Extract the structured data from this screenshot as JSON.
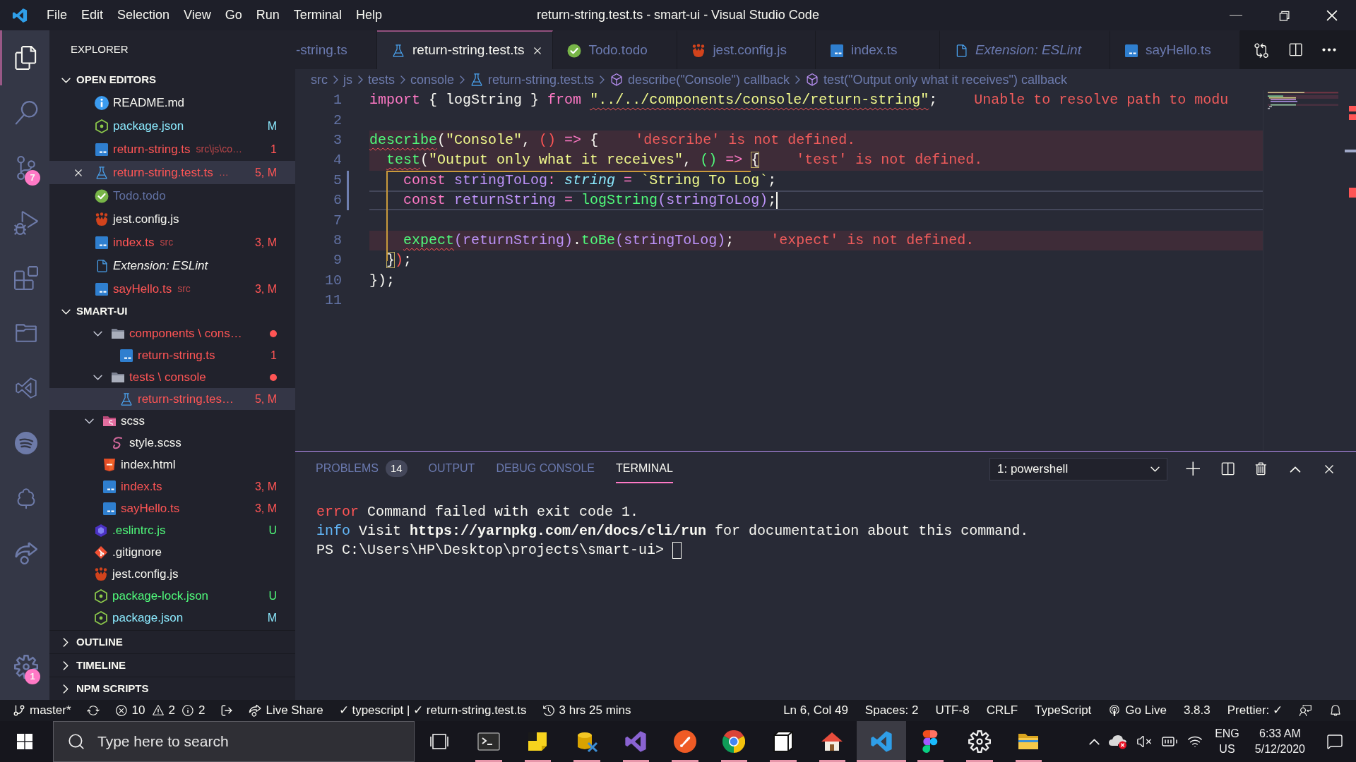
{
  "title_bar": {
    "menu": [
      "File",
      "Edit",
      "Selection",
      "View",
      "Go",
      "Run",
      "Terminal",
      "Help"
    ],
    "title": "return-string.test.ts - smart-ui - Visual Studio Code"
  },
  "activity_bar": {
    "items": [
      {
        "kind": "explorer",
        "selected": true
      },
      {
        "kind": "search",
        "selected": false
      },
      {
        "kind": "scm",
        "selected": false,
        "badge": "7"
      },
      {
        "kind": "debug",
        "selected": false
      },
      {
        "kind": "extensions",
        "selected": false
      },
      {
        "kind": "projects",
        "selected": false
      },
      {
        "kind": "studio",
        "selected": false
      },
      {
        "kind": "music",
        "selected": false
      },
      {
        "kind": "tests",
        "selected": false
      },
      {
        "kind": "share",
        "selected": false
      }
    ],
    "bottom": [
      {
        "kind": "settings",
        "selected": false,
        "badge": "1"
      }
    ]
  },
  "sidebar": {
    "title": "EXPLORER",
    "open_editors": {
      "title": "OPEN EDITORS",
      "expanded": true,
      "items": [
        {
          "label": "README.md",
          "kind": "info",
          "color": "#f8f8f2",
          "selected": false
        },
        {
          "label": "package.json",
          "kind": "node",
          "color": "#8be9fd",
          "badge": "M",
          "selected": false
        },
        {
          "label": "return-string.ts",
          "description": "src\\js\\co…",
          "kind": "ts",
          "color": "#ff5555",
          "badge": "1",
          "selected": false
        },
        {
          "label": "return-string.test.ts",
          "description": "…",
          "kind": "test",
          "color": "#ff5555",
          "badge": "5, M",
          "selected": true
        },
        {
          "label": "Todo.todo",
          "kind": "todo",
          "color": "#6272a4",
          "selected": false
        },
        {
          "label": "jest.config.js",
          "kind": "jest",
          "color": "#f8f8f2",
          "selected": false
        },
        {
          "label": "index.ts",
          "description": "src",
          "kind": "ts",
          "color": "#ff5555",
          "badge": "3, M",
          "selected": false
        },
        {
          "label": "Extension: ESLint",
          "kind": "extension",
          "color": "#f8f8f2",
          "selected": false
        },
        {
          "label": "sayHello.ts",
          "description": "src",
          "kind": "ts",
          "color": "#ff5555",
          "badge": "3, M",
          "selected": false
        }
      ]
    },
    "folder": {
      "title": "SMART-UI",
      "expanded": true,
      "items": [
        {
          "children": [
            {
              "children": [
                {
                  "label": "components \\ cons…",
                  "kind": "folder",
                  "color": "#ff5555",
                  "expanded": true,
                  "selected": false,
                  "children": [
                    {
                      "label": "return-string.ts",
                      "kind": "ts",
                      "color": "#ff5555",
                      "badge": "1",
                      "selected": false
                    }
                  ]
                },
                {
                  "label": "tests \\ console",
                  "kind": "folder",
                  "color": "#ff5555",
                  "expanded": true,
                  "selected": false,
                  "children": [
                    {
                      "label": "return-string.tes…",
                      "kind": "test",
                      "color": "#ff5555",
                      "badge": "5, M",
                      "selected": true
                    }
                  ]
                }
              ]
            },
            {
              "label": "scss",
              "kind": "sass-folder",
              "color": "#f8f8f2",
              "expanded": true,
              "selected": false,
              "children": [
                {
                  "label": "style.scss",
                  "kind": "scss",
                  "color": "#f8f8f2",
                  "selected": false
                }
              ]
            },
            {
              "label": "index.html",
              "kind": "html",
              "color": "#f8f8f2",
              "selected": false
            },
            {
              "label": "index.ts",
              "kind": "ts",
              "color": "#ff5555",
              "badge": "3, M",
              "selected": false
            },
            {
              "label": "sayHello.ts",
              "kind": "ts",
              "color": "#ff5555",
              "badge": "3, M",
              "selected": false
            }
          ]
        },
        {
          "label": ".eslintrc.js",
          "kind": "eslint",
          "color": "#50fa7b",
          "badge": "U",
          "selected": false
        },
        {
          "label": ".gitignore",
          "kind": "git",
          "color": "#f8f8f2",
          "selected": false
        },
        {
          "label": "jest.config.js",
          "kind": "jest",
          "color": "#f8f8f2",
          "selected": false
        },
        {
          "label": "package-lock.json",
          "kind": "node",
          "color": "#50fa7b",
          "badge": "U",
          "selected": false
        },
        {
          "label": "package.json",
          "kind": "node",
          "color": "#8be9fd",
          "badge": "M",
          "selected": false
        }
      ]
    },
    "sections": [
      {
        "title": "OUTLINE",
        "expanded": false
      },
      {
        "title": "TIMELINE",
        "expanded": false
      },
      {
        "title": "NPM SCRIPTS",
        "expanded": false
      }
    ]
  },
  "tabs": [
    {
      "label": "-string.ts",
      "kind": "partial",
      "selected": false
    },
    {
      "label": "return-string.test.ts",
      "kind": "test",
      "selected": true
    },
    {
      "label": "Todo.todo",
      "kind": "todo",
      "selected": false
    },
    {
      "label": "jest.config.js",
      "kind": "jest",
      "selected": false
    },
    {
      "label": "index.ts",
      "kind": "ts",
      "selected": false
    },
    {
      "label": "Extension: ESLint",
      "kind": "extension",
      "selected": false
    },
    {
      "label": "sayHello.ts",
      "kind": "ts",
      "selected": false
    }
  ],
  "breadcrumb": [
    {
      "label": "src",
      "kind": "folder"
    },
    {
      "label": "js",
      "kind": "folder"
    },
    {
      "label": "tests",
      "kind": "folder"
    },
    {
      "label": "console",
      "kind": "folder"
    },
    {
      "label": "return-string.test.ts",
      "kind": "test"
    },
    {
      "label": "describe(\"Console\") callback",
      "kind": "symbol"
    },
    {
      "label": "test(\"Output only what it receives\") callback",
      "kind": "symbol"
    }
  ],
  "editor": {
    "lines": [
      {
        "number": "1",
        "highlight": false,
        "current": false,
        "changed": false,
        "tokens": [
          {
            "text": "import",
            "kind": "keyword"
          },
          {
            "text": " { ",
            "kind": "punct"
          },
          {
            "text": "logString",
            "kind": "plain"
          },
          {
            "text": " } ",
            "kind": "punct"
          },
          {
            "text": "from ",
            "kind": "keyword"
          },
          {
            "text": "\"../../components/console/return-string\"",
            "kind": "string",
            "squiggle": true
          },
          {
            "text": ";",
            "kind": "punct"
          }
        ],
        "message": "Unable to resolve path to modu"
      },
      {
        "number": "2",
        "highlight": false,
        "current": false,
        "changed": false
      },
      {
        "number": "3",
        "highlight": true,
        "current": false,
        "changed": false,
        "tokens": [
          {
            "text": "describe",
            "kind": "function",
            "squiggle": true
          },
          {
            "text": "(",
            "kind": "punct"
          },
          {
            "text": "\"Console\"",
            "kind": "string"
          },
          {
            "text": ", ",
            "kind": "punct"
          },
          {
            "text": "()",
            "kind": "paren-red"
          },
          {
            "text": " => ",
            "kind": "keyword"
          },
          {
            "text": "{",
            "kind": "punct"
          }
        ],
        "message": "'describe' is not defined."
      },
      {
        "number": "4",
        "highlight": true,
        "current": false,
        "changed": false,
        "tokens": [
          {
            "text": "  test",
            "kind": "function",
            "squiggle": true
          },
          {
            "text": "(",
            "kind": "punct"
          },
          {
            "text": "\"Output only what it receives\"",
            "kind": "string"
          },
          {
            "text": ", ",
            "kind": "punct"
          },
          {
            "text": "()",
            "kind": "paren-green"
          },
          {
            "text": " => ",
            "kind": "keyword"
          },
          {
            "text": "{",
            "kind": "bracket-match"
          }
        ],
        "message": "'test' is not defined."
      },
      {
        "number": "5",
        "highlight": false,
        "current": false,
        "changed": true,
        "tokens": [
          {
            "text": "    const ",
            "kind": "keyword"
          },
          {
            "text": "stringToLog",
            "kind": "variable"
          },
          {
            "text": ": ",
            "kind": "keyword"
          },
          {
            "text": "string",
            "kind": "type"
          },
          {
            "text": " = ",
            "kind": "keyword"
          },
          {
            "text": "`String To Log`",
            "kind": "string"
          },
          {
            "text": ";",
            "kind": "punct"
          }
        ]
      },
      {
        "number": "6",
        "highlight": false,
        "current": true,
        "changed": true,
        "tokens": [
          {
            "text": "    const ",
            "kind": "keyword"
          },
          {
            "text": "returnString",
            "kind": "variable"
          },
          {
            "text": " = ",
            "kind": "keyword"
          },
          {
            "text": "logString",
            "kind": "function"
          },
          {
            "text": "(",
            "kind": "paren-purple"
          },
          {
            "text": "stringToLog",
            "kind": "variable"
          },
          {
            "text": ")",
            "kind": "paren-purple"
          },
          {
            "text": ";",
            "kind": "punct"
          }
        ]
      },
      {
        "number": "7",
        "highlight": false,
        "current": false,
        "changed": false
      },
      {
        "number": "8",
        "highlight": true,
        "current": false,
        "changed": false,
        "tokens": [
          {
            "text": "    expect",
            "kind": "function",
            "squiggle": true
          },
          {
            "text": "(",
            "kind": "paren-purple"
          },
          {
            "text": "returnString",
            "kind": "variable"
          },
          {
            "text": ")",
            "kind": "paren-purple"
          },
          {
            "text": ".",
            "kind": "punct"
          },
          {
            "text": "toBe",
            "kind": "function"
          },
          {
            "text": "(",
            "kind": "paren-purple"
          },
          {
            "text": "stringToLog",
            "kind": "variable"
          },
          {
            "text": ")",
            "kind": "paren-purple"
          },
          {
            "text": ";",
            "kind": "punct"
          }
        ],
        "message": "'expect' is not defined."
      },
      {
        "number": "9",
        "highlight": false,
        "current": false,
        "changed": false,
        "tokens": [
          {
            "text": "  }",
            "kind": "bracket-match"
          },
          {
            "text": ")",
            "kind": "paren-red"
          },
          {
            "text": ";",
            "kind": "punct"
          }
        ]
      },
      {
        "number": "10",
        "highlight": false,
        "current": false,
        "changed": false,
        "tokens": [
          {
            "text": "});",
            "kind": "punct"
          }
        ]
      },
      {
        "number": "11",
        "highlight": false,
        "current": false,
        "changed": false
      }
    ]
  },
  "panel": {
    "tabs": [
      {
        "label": "PROBLEMS",
        "badge": "14",
        "selected": false
      },
      {
        "label": "OUTPUT",
        "selected": false
      },
      {
        "label": "DEBUG CONSOLE",
        "selected": false
      },
      {
        "label": "TERMINAL",
        "selected": true
      }
    ],
    "terminal_select": {
      "value": "1: powershell"
    },
    "terminal": [
      {
        "kind": "error",
        "prefix": "error",
        "text": "Command failed with exit code 1."
      },
      {
        "kind": "info",
        "prefix": "info",
        "text": "Visit **https://yarnpkg.com/en/docs/cli/run** for documentation about this command."
      },
      {
        "kind": "prompt",
        "text": "PS C:\\Users\\HP\\Desktop\\projects\\smart-ui>"
      }
    ]
  },
  "status_bar": {
    "left": [
      {
        "kind": "branch",
        "text": "master*"
      },
      {
        "kind": "sync"
      },
      {
        "kind": "problems",
        "errors": "10",
        "warnings": "2",
        "infos": "2"
      },
      {
        "kind": "signout"
      },
      {
        "kind": "liveshare",
        "text": "Live Share"
      },
      {
        "kind": "text",
        "text": "✓ typescript | ✓ return-string.test.ts"
      },
      {
        "kind": "history",
        "text": "3 hrs 25 mins"
      }
    ],
    "right": [
      {
        "kind": "text",
        "text": "Ln 6, Col 49"
      },
      {
        "kind": "text",
        "text": "Spaces: 2"
      },
      {
        "kind": "text",
        "text": "UTF-8"
      },
      {
        "kind": "text",
        "text": "CRLF"
      },
      {
        "kind": "text",
        "text": "TypeScript"
      },
      {
        "kind": "golive",
        "text": "Go Live"
      },
      {
        "kind": "text",
        "text": "3.8.3"
      },
      {
        "kind": "text",
        "text": "Prettier: ✓"
      },
      {
        "kind": "feedback"
      },
      {
        "kind": "bell"
      }
    ]
  },
  "taskbar": {
    "search": {
      "placeholder": "Type here to search"
    },
    "apps": [
      {
        "kind": "terminal",
        "running": true,
        "selected": false
      },
      {
        "kind": "notes",
        "running": true,
        "selected": false
      },
      {
        "kind": "database",
        "running": true,
        "selected": false
      },
      {
        "kind": "studio",
        "running": true,
        "selected": false
      },
      {
        "kind": "postman",
        "running": true,
        "selected": false
      },
      {
        "kind": "chrome",
        "running": true,
        "selected": false
      },
      {
        "kind": "notion",
        "running": true,
        "selected": false
      },
      {
        "kind": "home",
        "running": true,
        "selected": false
      },
      {
        "kind": "vscode",
        "running": true,
        "selected": true
      },
      {
        "kind": "figma",
        "running": true,
        "selected": false
      },
      {
        "kind": "settings",
        "running": true,
        "selected": false
      },
      {
        "kind": "files",
        "running": true,
        "selected": false
      }
    ],
    "tray": {
      "language": "ENG",
      "region": "US",
      "time": "6:33 AM",
      "date": "5/12/2020"
    }
  }
}
